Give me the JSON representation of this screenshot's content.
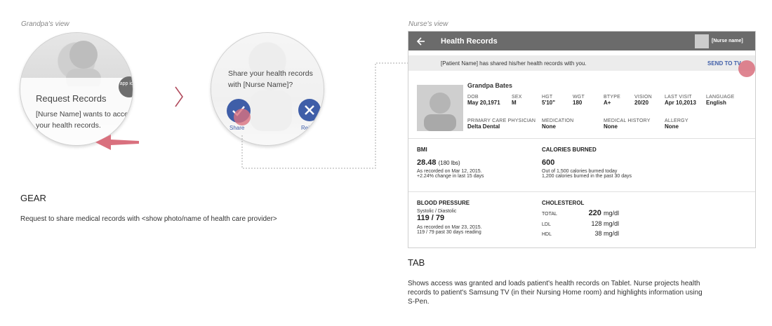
{
  "gear": {
    "caption": "Grandpa's view",
    "watch1": {
      "title": "Request Records",
      "message": "[Nurse Name] wants to access your health records.",
      "app_badge": "app icon"
    },
    "watch2": {
      "prompt": "Share your health records with [Nurse Name]?",
      "share_label": "Share",
      "reject_label": "Reject"
    },
    "section_title": "GEAR",
    "description": "Request to share medical records with <show photo/name of health care provider>"
  },
  "tab": {
    "caption": "Nurse's view",
    "header_title": "Health Records",
    "nurse_label": "[Nurse name]",
    "banner_text": "[Patient Name] has shared his/her health records with you.",
    "send_to_tv": "SEND TO TV",
    "patient": {
      "name": "Grandpa Bates",
      "fields": [
        {
          "label": "DOB",
          "value": "May 20,1971"
        },
        {
          "label": "SEX",
          "value": "M"
        },
        {
          "label": "HGT",
          "value": "5'10\""
        },
        {
          "label": "WGT",
          "value": "180"
        },
        {
          "label": "BTYPE",
          "value": "A+"
        },
        {
          "label": "VISION",
          "value": "20/20"
        },
        {
          "label": "LAST VISIT",
          "value": "Apr 10,2013"
        },
        {
          "label": "LANGUAGE",
          "value": "English"
        }
      ],
      "fields2": [
        {
          "label": "PRIMARY CARE PHYSICIAN",
          "value": "Delta Dental"
        },
        {
          "label": "MEDICATION",
          "value": "None"
        },
        {
          "label": "MEDICAL HISTORY",
          "value": "None"
        },
        {
          "label": "ALLERGY",
          "value": "None"
        }
      ]
    },
    "bmi": {
      "title": "BMI",
      "value": "28.48",
      "unit": "(180 lbs)",
      "line1": "As recorded on Mar 12, 2015.",
      "line2": "+2.24%  change in last 15 days"
    },
    "calories": {
      "title": "CALORIES BURNED",
      "value": "600",
      "line1": "Out of 1,500 calories burned today",
      "line2": "1,200 calories burned in the past 30 days"
    },
    "bp": {
      "title": "BLOOD PRESSURE",
      "sublabel": "Systolic / Diastolic",
      "value": "119 / 79",
      "line1": "As recorded on Mar 23, 2015.",
      "line2": "119 / 79  past 30 days reading"
    },
    "cholesterol": {
      "title": "CHOLESTEROL",
      "rows": [
        {
          "label": "TOTAL",
          "value": "220",
          "unit": "mg/dl"
        },
        {
          "label": "LDL",
          "value": "128",
          "unit": "mg/dl"
        },
        {
          "label": "HDL",
          "value": "38",
          "unit": "mg/dl"
        }
      ]
    },
    "section_title": "TAB",
    "description": "Shows access was granted and loads patient's health records on Tablet. Nurse projects health records to patient's Samsung TV (in their Nursing Home room) and highlights information using S-Pen."
  },
  "colors": {
    "accent_blue": "#3f5ea8",
    "highlight_pink": "#d9707e",
    "header_gray": "#6b6b6b"
  }
}
